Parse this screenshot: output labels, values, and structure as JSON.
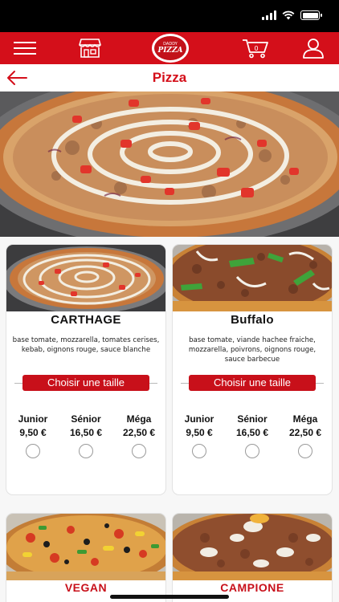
{
  "status_bar": {
    "time": ""
  },
  "nav": {
    "menu_icon": "hamburger-menu-icon",
    "store_icon": "storefront-icon",
    "logo_line1": "DADDY",
    "logo_line2": "PIZZA",
    "cart_icon": "cart-icon",
    "cart_count": "0",
    "profile_icon": "user-icon"
  },
  "header": {
    "back_icon": "arrow-left-icon",
    "title": "Pizza"
  },
  "products": [
    {
      "name": "CARTHAGE",
      "description": "base tomate, mozzarella, tomates cerises, kebab, oignons rouge, sauce blanche",
      "size_button": "Choisir une taille",
      "sizes": [
        {
          "label": "Junior",
          "price": "9,50 €"
        },
        {
          "label": "Sénior",
          "price": "16,50 €"
        },
        {
          "label": "Méga",
          "price": "22,50 €"
        }
      ]
    },
    {
      "name": "Buffalo",
      "description": "base tomate, viande hachee fraiche, mozzarella, poivrons, oignons rouge, sauce barbecue",
      "size_button": "Choisir une taille",
      "sizes": [
        {
          "label": "Junior",
          "price": "9,50 €"
        },
        {
          "label": "Sénior",
          "price": "16,50 €"
        },
        {
          "label": "Méga",
          "price": "22,50 €"
        }
      ]
    },
    {
      "name": "VEGAN"
    },
    {
      "name": "CAMPIONE"
    }
  ],
  "colors": {
    "brand_red": "#d40f1a",
    "button_red": "#c8101a"
  }
}
